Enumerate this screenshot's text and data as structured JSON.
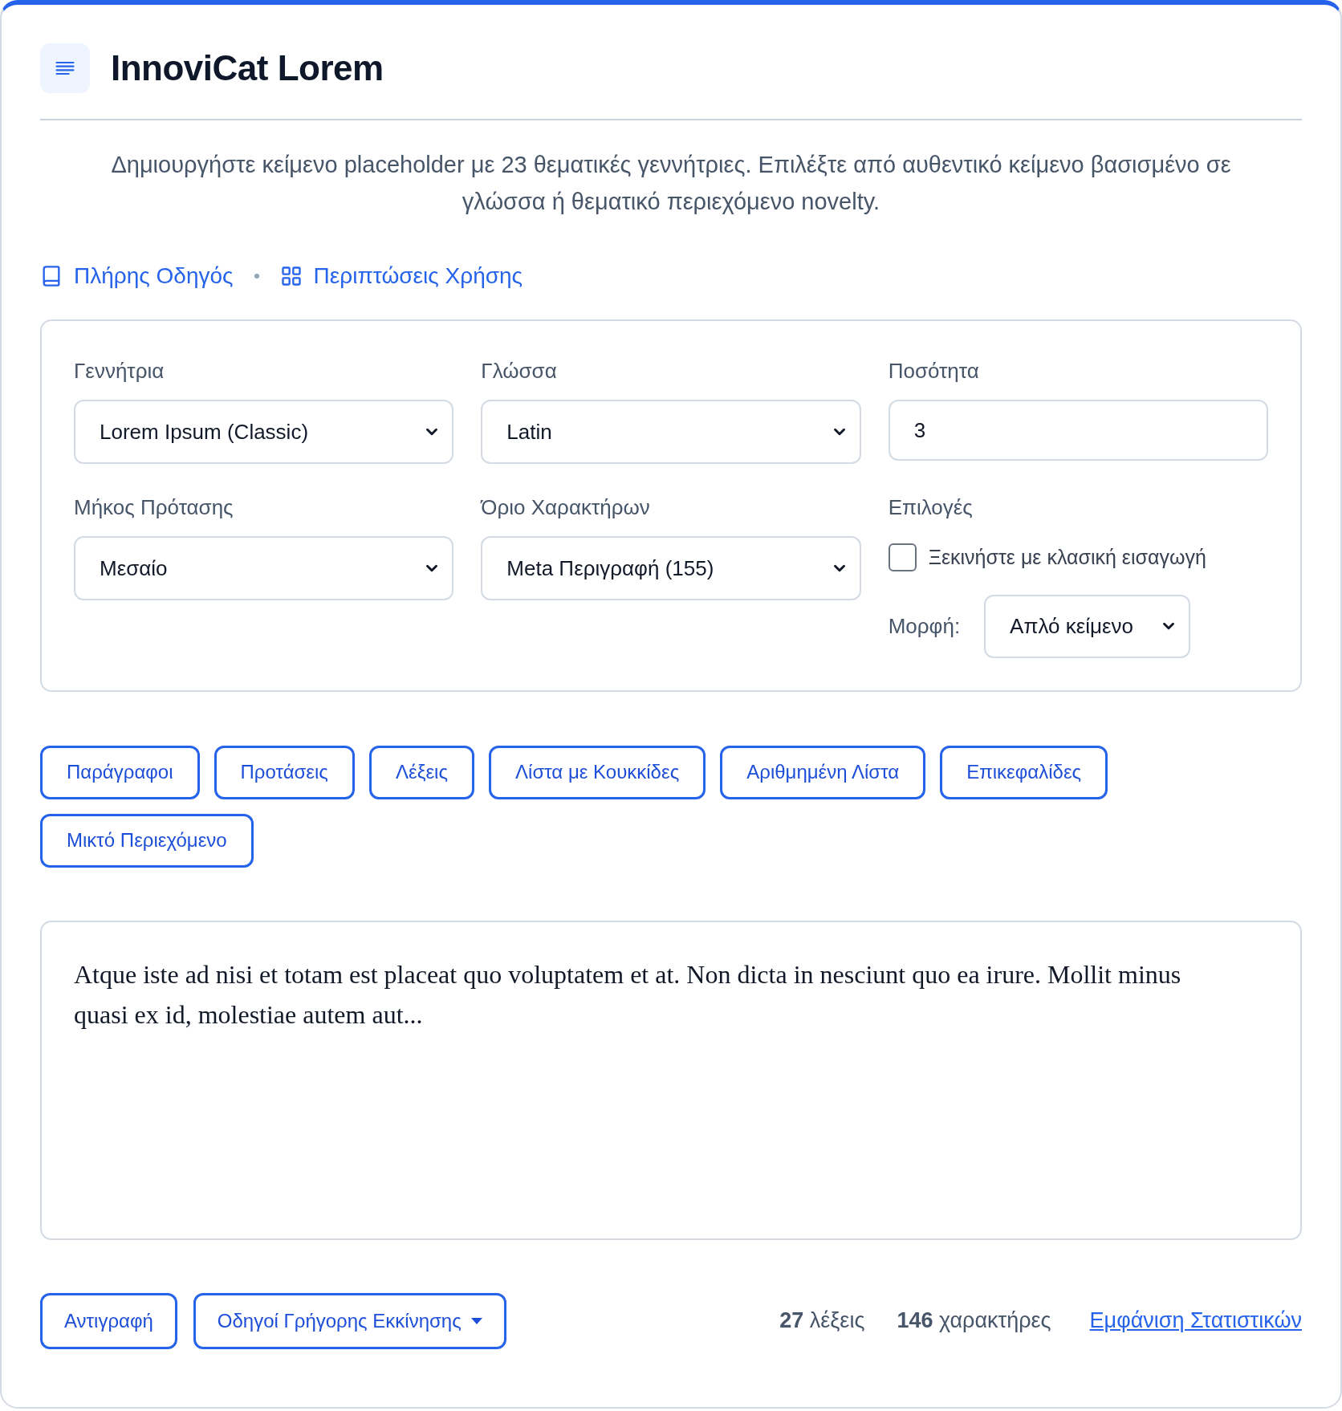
{
  "header": {
    "title": "InnoviCat Lorem",
    "description": "Δημιουργήστε κείμενο placeholder με 23 θεματικές γεννήτριες. Επιλέξτε από αυθεντικό κείμενο βασισμένο σε γλώσσα ή θεματικό περιεχόμενο novelty."
  },
  "links": [
    {
      "label": "Πλήρης Οδηγός",
      "kind": "book"
    },
    {
      "label": "Περιπτώσεις Χρήσης",
      "kind": "grid"
    }
  ],
  "settings": {
    "fields": [
      {
        "kind": "select",
        "label": "Γεννήτρια",
        "value": "Lorem Ipsum (Classic)"
      },
      {
        "kind": "select",
        "label": "Γλώσσα",
        "value": "Latin"
      },
      {
        "kind": "number",
        "label": "Ποσότητα",
        "value": "3"
      },
      {
        "kind": "select",
        "label": "Μήκος Πρότασης",
        "value": "Μεσαίο"
      },
      {
        "kind": "select",
        "label": "Όριο Χαρακτήρων",
        "value": "Meta Περιγραφή (155)"
      }
    ],
    "options": {
      "label": "Επιλογές",
      "checkbox": {
        "label": "Ξεκινήστε με κλασική εισαγωγή",
        "checked": false
      },
      "format": {
        "label": "Μορφή:",
        "value": "Απλό κείμενο"
      }
    }
  },
  "content_types": [
    "Παράγραφοι",
    "Προτάσεις",
    "Λέξεις",
    "Λίστα με Κουκκίδες",
    "Αριθμημένη Λίστα",
    "Επικεφαλίδες",
    "Μικτό Περιεχόμενο"
  ],
  "output": {
    "text": "Atque iste ad nisi et totam est placeat quo voluptatem et at. Non dicta in nesciunt quo ea irure. Mollit minus quasi ex id, molestiae autem aut..."
  },
  "footer": {
    "buttons": [
      {
        "label": "Αντιγραφή",
        "kind": "plain"
      },
      {
        "label": "Οδηγοί Γρήγορης Εκκίνησης",
        "kind": "dropdown"
      }
    ],
    "stats": [
      "**27** λέξεις",
      "**146** χαρακτήρες"
    ],
    "link": "Εμφάνιση Στατιστικών"
  }
}
